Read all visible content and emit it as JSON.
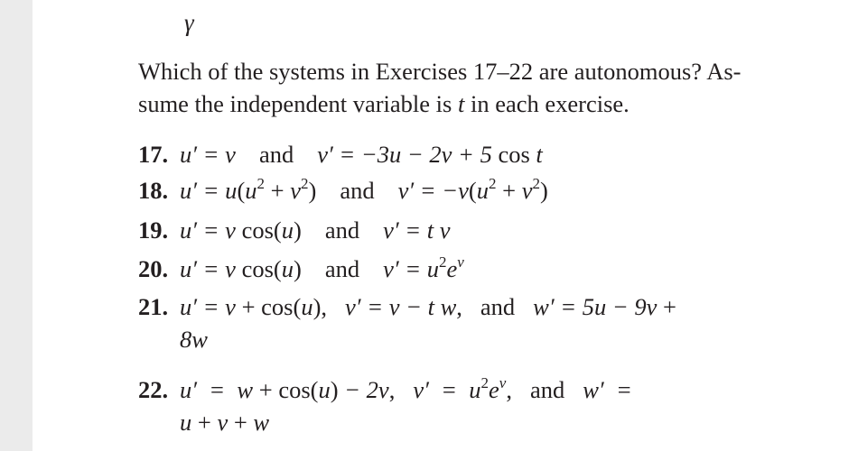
{
  "page": {
    "fragment_above": "γ",
    "intro": {
      "line1": "Which of the systems in Exercises 17–22 are autonomous? As-",
      "line2_pre": "sume the independent variable is ",
      "line2_var": "t",
      "line2_post": " in each exercise."
    },
    "connective": "and",
    "exercises": [
      {
        "number": "17.",
        "parts": [
          "u′ = v",
          "v′ = −3u − 2v + 5 cos t"
        ]
      },
      {
        "number": "18.",
        "parts": [
          "u′ = u(u² + v²)",
          "v′ = −v(u² + v²)"
        ]
      },
      {
        "number": "19.",
        "parts": [
          "u′ = v cos(u)",
          "v′ = tv"
        ]
      },
      {
        "number": "20.",
        "parts": [
          "u′ = v cos(u)",
          "v′ = u²e^v"
        ]
      },
      {
        "number": "21.",
        "parts": [
          "u′ = v + cos(u),",
          "v′ = v − tw,",
          "w′ = 5u − 9v + 8w"
        ],
        "line1": "u′ = v + cos(u),    v′ = v − tw,    and    w′ = 5u − 9v +",
        "line2": "8w"
      },
      {
        "number": "22.",
        "parts": [
          "u′ = w + cos(u) − 2v,",
          "v′ = u²e^v,",
          "w′ = u + v + w"
        ],
        "line1": "u′ = w + cos(u) − 2v,    v′ = u²e^v,    and    w′ =",
        "line2": "u + v + w"
      }
    ]
  }
}
